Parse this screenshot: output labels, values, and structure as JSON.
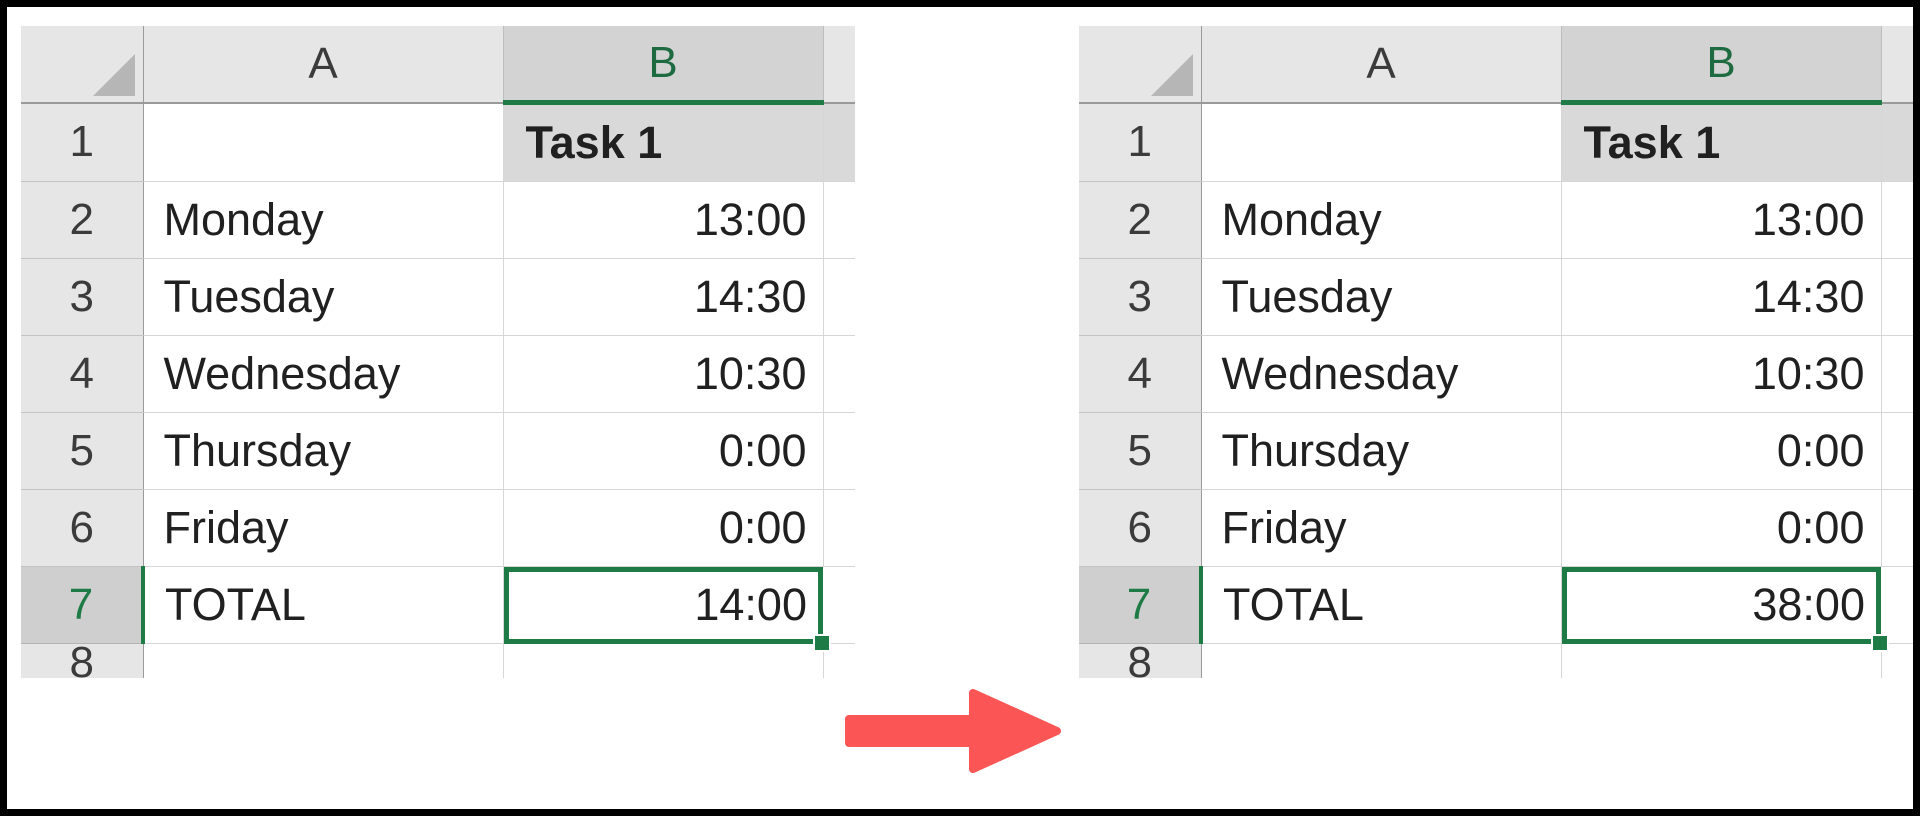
{
  "accent": {
    "selection_green": "#1e7b45",
    "arrow_red": "#FB5555",
    "header_gray": "#e6e6e6",
    "selected_header_gray": "#cfcfcf"
  },
  "arrow": {
    "name": "right-arrow",
    "color": "#FB5555",
    "direction": "right"
  },
  "sheets": [
    {
      "id": "before",
      "corner_icon": "select-all-triangle",
      "columns": [
        {
          "label": "A",
          "selected": false
        },
        {
          "label": "B",
          "selected": true
        }
      ],
      "rows": [
        {
          "number": "1",
          "a": "",
          "b": "Task 1",
          "header_cell": true,
          "selected": false
        },
        {
          "number": "2",
          "a": "Monday",
          "b": "13:00",
          "header_cell": false,
          "selected": false
        },
        {
          "number": "3",
          "a": "Tuesday",
          "b": "14:30",
          "header_cell": false,
          "selected": false
        },
        {
          "number": "4",
          "a": "Wednesday",
          "b": "10:30",
          "header_cell": false,
          "selected": false
        },
        {
          "number": "5",
          "a": "Thursday",
          "b": "0:00",
          "header_cell": false,
          "selected": false
        },
        {
          "number": "6",
          "a": "Friday",
          "b": "0:00",
          "header_cell": false,
          "selected": false
        },
        {
          "number": "7",
          "a": "TOTAL",
          "b": "14:00",
          "header_cell": false,
          "selected": true
        },
        {
          "number": "8",
          "a": "",
          "b": "",
          "header_cell": false,
          "selected": false
        }
      ],
      "active_cell": {
        "ref": "B7",
        "value": "14:00",
        "fill_handle": true
      }
    },
    {
      "id": "after",
      "corner_icon": "select-all-triangle",
      "columns": [
        {
          "label": "A",
          "selected": false
        },
        {
          "label": "B",
          "selected": true
        }
      ],
      "rows": [
        {
          "number": "1",
          "a": "",
          "b": "Task 1",
          "header_cell": true,
          "selected": false
        },
        {
          "number": "2",
          "a": "Monday",
          "b": "13:00",
          "header_cell": false,
          "selected": false
        },
        {
          "number": "3",
          "a": "Tuesday",
          "b": "14:30",
          "header_cell": false,
          "selected": false
        },
        {
          "number": "4",
          "a": "Wednesday",
          "b": "10:30",
          "header_cell": false,
          "selected": false
        },
        {
          "number": "5",
          "a": "Thursday",
          "b": "0:00",
          "header_cell": false,
          "selected": false
        },
        {
          "number": "6",
          "a": "Friday",
          "b": "0:00",
          "header_cell": false,
          "selected": false
        },
        {
          "number": "7",
          "a": "TOTAL",
          "b": "38:00",
          "header_cell": false,
          "selected": true
        },
        {
          "number": "8",
          "a": "",
          "b": "",
          "header_cell": false,
          "selected": false
        }
      ],
      "active_cell": {
        "ref": "B7",
        "value": "38:00",
        "fill_handle": true
      }
    }
  ]
}
